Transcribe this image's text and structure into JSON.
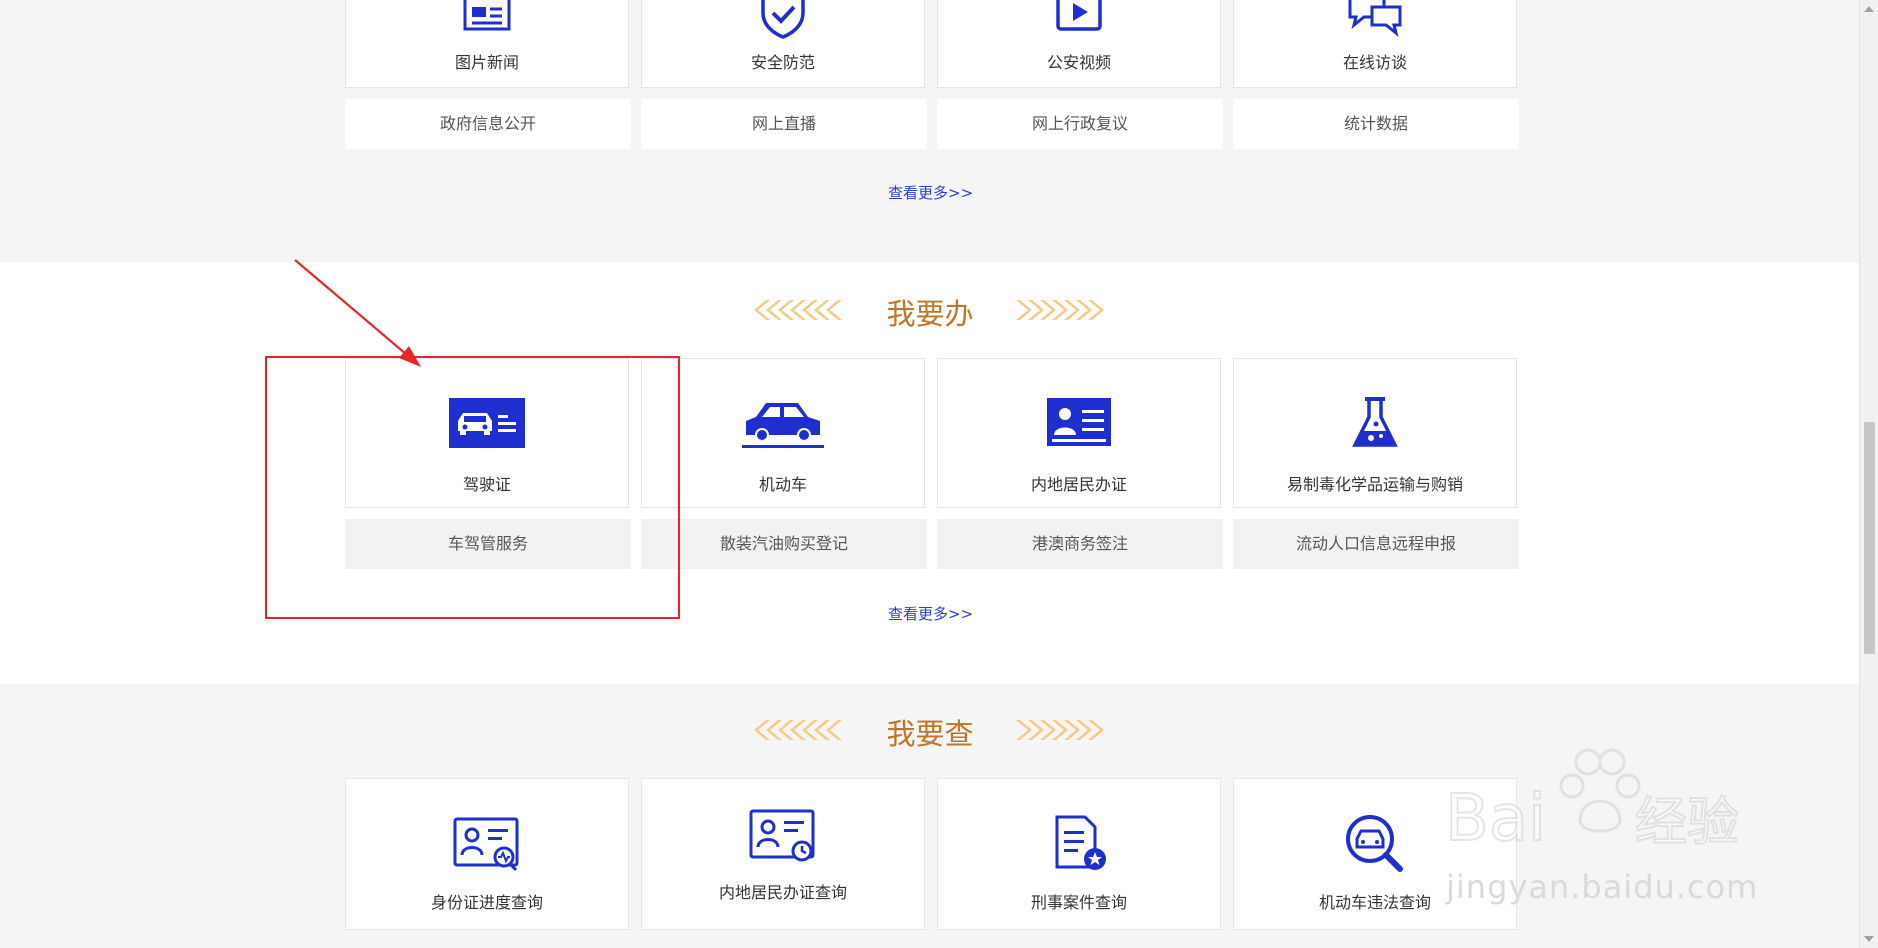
{
  "top_section": {
    "cards": [
      {
        "label": "图片新闻",
        "icon": "newspaper-icon"
      },
      {
        "label": "安全防范",
        "icon": "shield-check-icon"
      },
      {
        "label": "公安视频",
        "icon": "video-play-icon"
      },
      {
        "label": "在线访谈",
        "icon": "chat-bubbles-icon"
      }
    ],
    "tiles": [
      "政府信息公开",
      "网上直播",
      "网上行政复议",
      "统计数据"
    ],
    "more_label": "查看更多>>"
  },
  "do_section": {
    "title": "我要办",
    "cards": [
      {
        "label": "驾驶证",
        "icon": "driver-license-icon"
      },
      {
        "label": "机动车",
        "icon": "car-icon"
      },
      {
        "label": "内地居民办证",
        "icon": "id-card-icon"
      },
      {
        "label": "易制毒化学品运输与购销",
        "icon": "chemical-flask-icon"
      }
    ],
    "tiles": [
      "车驾管服务",
      "散装汽油购买登记",
      "港澳商务签注",
      "流动人口信息远程申报"
    ],
    "more_label": "查看更多>>"
  },
  "query_section": {
    "title": "我要查",
    "cards": [
      {
        "label": "身份证进度查询",
        "icon": "id-progress-search-icon"
      },
      {
        "label": "内地居民办证查询",
        "icon": "id-clock-icon"
      },
      {
        "label": "刑事案件查询",
        "icon": "document-star-icon"
      },
      {
        "label": "机动车违法查询",
        "icon": "car-search-icon"
      }
    ]
  },
  "watermark": {
    "brand": "Baidu经验",
    "url": "jingyan.baidu.com"
  },
  "colors": {
    "accent_blue": "#1f2fcf",
    "title_orange": "#c0762a",
    "chevron": "#f5c98a",
    "annotation_red": "#e8262a",
    "gray_band": "#f5f5f5"
  }
}
